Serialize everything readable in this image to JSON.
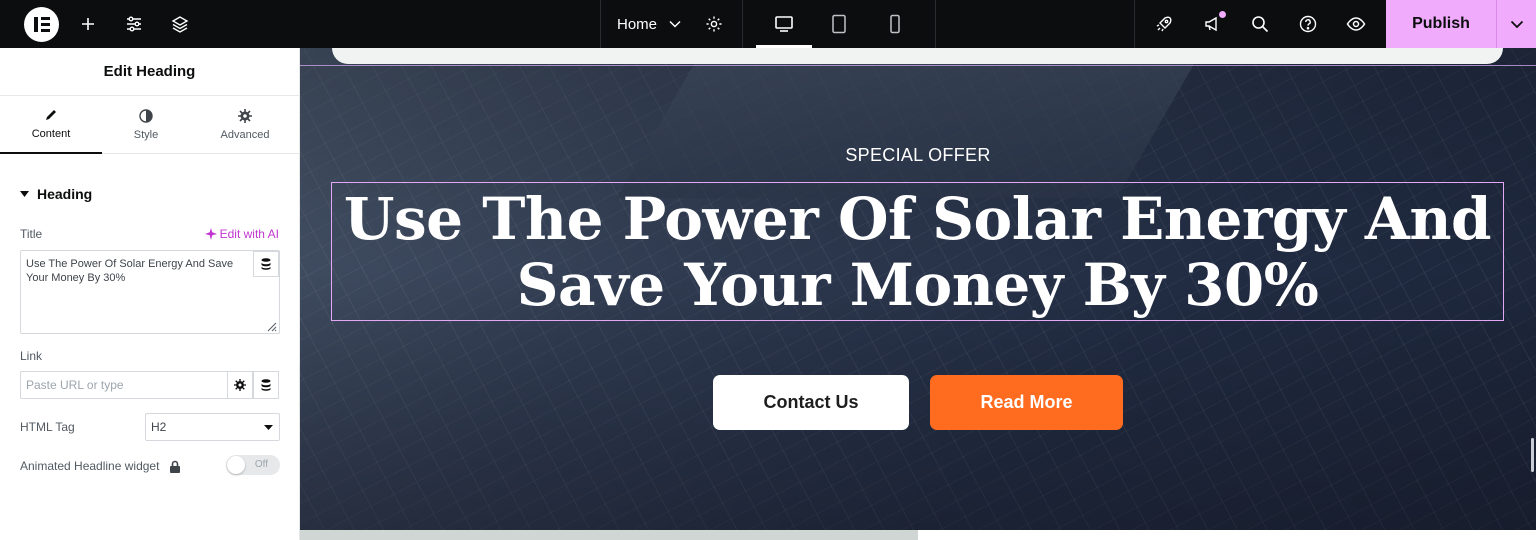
{
  "topbar": {
    "page_name": "Home",
    "publish_label": "Publish"
  },
  "panel": {
    "title": "Edit Heading",
    "tabs": [
      {
        "label": "Content"
      },
      {
        "label": "Style"
      },
      {
        "label": "Advanced"
      }
    ],
    "section": "Heading",
    "title_label": "Title",
    "ai_link": "Edit with AI",
    "title_value": "Use The Power Of Solar Energy And Save Your Money By 30%",
    "link_label": "Link",
    "link_placeholder": "Paste URL or type",
    "html_tag_label": "HTML Tag",
    "html_tag_value": "H2",
    "animated_label": "Animated Headline widget",
    "toggle_state": "Off"
  },
  "canvas": {
    "eyebrow": "SPECIAL OFFER",
    "heading_line1": "Use The Power Of Solar Energy And",
    "heading_line2": "Save Your Money By 30%",
    "btn_contact": "Contact Us",
    "btn_read": "Read More"
  },
  "colors": {
    "accent": "#f0abfc",
    "ai": "#c036d0",
    "orange": "#ff6b1f",
    "topbar_bg": "#0c0d0e"
  }
}
